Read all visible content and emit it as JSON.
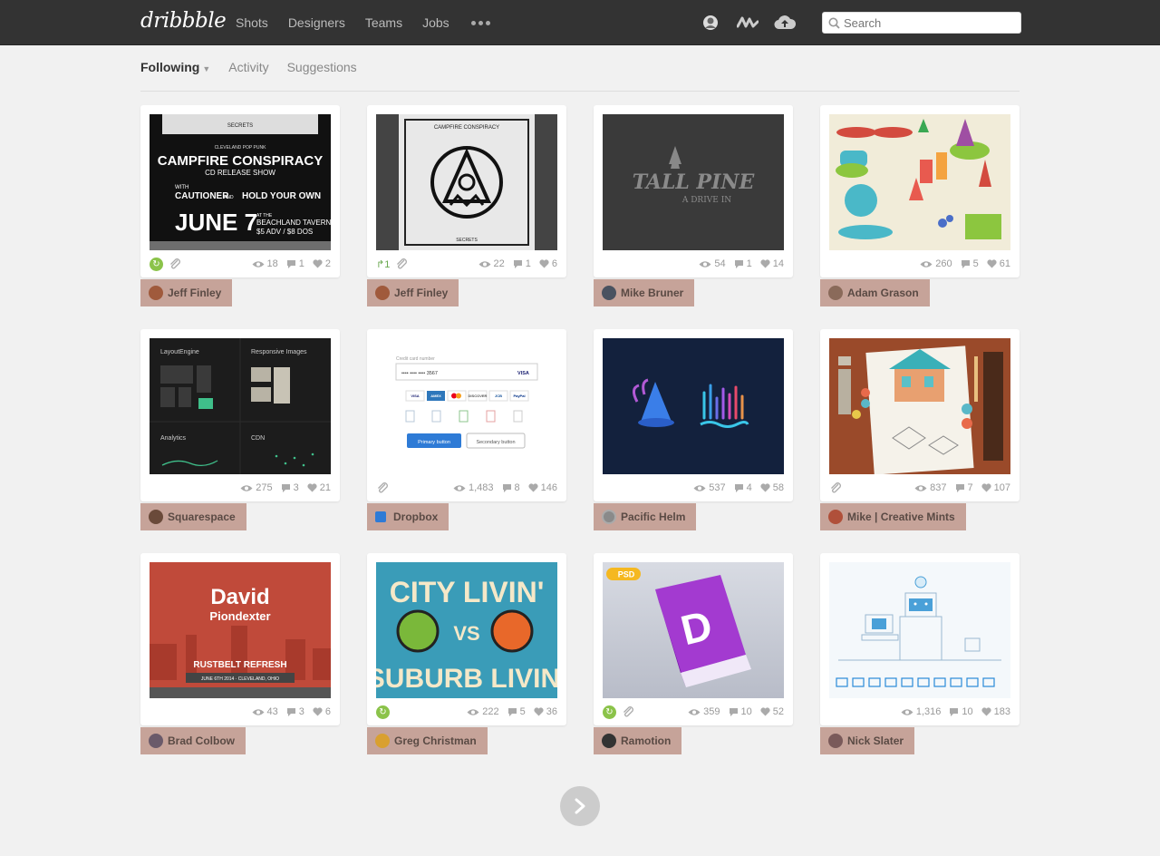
{
  "header": {
    "logo": "dribbble",
    "nav": [
      "Shots",
      "Designers",
      "Teams",
      "Jobs"
    ],
    "search_placeholder": "Search"
  },
  "subnav": {
    "tabs": [
      "Following",
      "Activity",
      "Suggestions"
    ]
  },
  "shots": [
    {
      "views": "18",
      "comments": "1",
      "likes": "2",
      "author": "Jeff Finley",
      "rebound": true,
      "rebound_count": "",
      "attachment": true,
      "avatar_color": "#a05a3c"
    },
    {
      "views": "22",
      "comments": "1",
      "likes": "6",
      "author": "Jeff Finley",
      "rebound": false,
      "rebound_count": "1",
      "attachment": true,
      "avatar_color": "#a05a3c"
    },
    {
      "views": "54",
      "comments": "1",
      "likes": "14",
      "author": "Mike Bruner",
      "rebound": false,
      "rebound_count": "",
      "attachment": false,
      "avatar_color": "#4a5260"
    },
    {
      "views": "260",
      "comments": "5",
      "likes": "61",
      "author": "Adam Grason",
      "rebound": false,
      "rebound_count": "",
      "attachment": false,
      "avatar_color": "#8a6a5a"
    },
    {
      "views": "275",
      "comments": "3",
      "likes": "21",
      "author": "Squarespace",
      "rebound": false,
      "rebound_count": "",
      "attachment": false,
      "avatar_color": "#6a4a3a"
    },
    {
      "views": "1,483",
      "comments": "8",
      "likes": "146",
      "author": "Dropbox",
      "rebound": false,
      "rebound_count": "",
      "attachment": true,
      "avatar_color": "#2e7bd6"
    },
    {
      "views": "537",
      "comments": "4",
      "likes": "58",
      "author": "Pacific Helm",
      "rebound": false,
      "rebound_count": "",
      "attachment": false,
      "avatar_color": "#8a8a8a"
    },
    {
      "views": "837",
      "comments": "7",
      "likes": "107",
      "author": "Mike | Creative Mints",
      "rebound": false,
      "rebound_count": "",
      "attachment": true,
      "avatar_color": "#b0503a"
    },
    {
      "views": "43",
      "comments": "3",
      "likes": "6",
      "author": "Brad Colbow",
      "rebound": false,
      "rebound_count": "",
      "attachment": false,
      "avatar_color": "#6a5a6a"
    },
    {
      "views": "222",
      "comments": "5",
      "likes": "36",
      "author": "Greg Christman",
      "rebound": true,
      "rebound_count": "",
      "attachment": false,
      "avatar_color": "#d9a030"
    },
    {
      "views": "359",
      "comments": "10",
      "likes": "52",
      "author": "Ramotion",
      "rebound": true,
      "rebound_count": "",
      "attachment": true,
      "avatar_color": "#333333"
    },
    {
      "views": "1,316",
      "comments": "10",
      "likes": "183",
      "author": "Nick Slater",
      "rebound": false,
      "rebound_count": "",
      "attachment": false,
      "avatar_color": "#7a5a5a"
    }
  ],
  "shot_art": {
    "campfire_poster": {
      "kicker": "CLEVELAND POP PUNK",
      "title": "CAMPFIRE CONSPIRACY",
      "subtitle": "CD RELEASE SHOW",
      "with": "WITH",
      "band1": "CAUTIONER",
      "and": "AND",
      "band2": "HOLD YOUR OWN",
      "date": "JUNE 7",
      "at": "AT THE",
      "venue": "BEACHLAND TAVERN",
      "price": "$5 ADV / $8 DOS",
      "top_text": "SECRETS"
    },
    "campfire_badge": {
      "top": "CAMPFIRE CONSPIRACY",
      "bottom": "SECRETS"
    },
    "tall_pine": {
      "line1": "TALL PINE",
      "line2": "A DRIVE IN"
    },
    "squarespace_labels": [
      "LayoutEngine",
      "Responsive Images",
      "Analytics",
      "CDN"
    ],
    "dropbox_form": {
      "label": "Credit card number",
      "value": "•••• •••• •••• 3567",
      "card_brand": "VISA",
      "cards": [
        "VISA",
        "AMEX",
        "",
        "DISCOVER",
        "JCB",
        "PayPal"
      ],
      "primary": "Primary button",
      "secondary": "Secondary button"
    },
    "brad_poster": {
      "first": "David",
      "last": "Piondexter",
      "banner": "RUSTBELT REFRESH",
      "date": "JUNE 6TH 2014 · CLEVELAND, OHIO"
    },
    "city_poster": {
      "line1": "CITY LIVIN'",
      "vs": "VS",
      "line2": "SUBURB LIVIN'"
    },
    "ramotion_badge": "PSD",
    "ramotion_letter": "D"
  }
}
